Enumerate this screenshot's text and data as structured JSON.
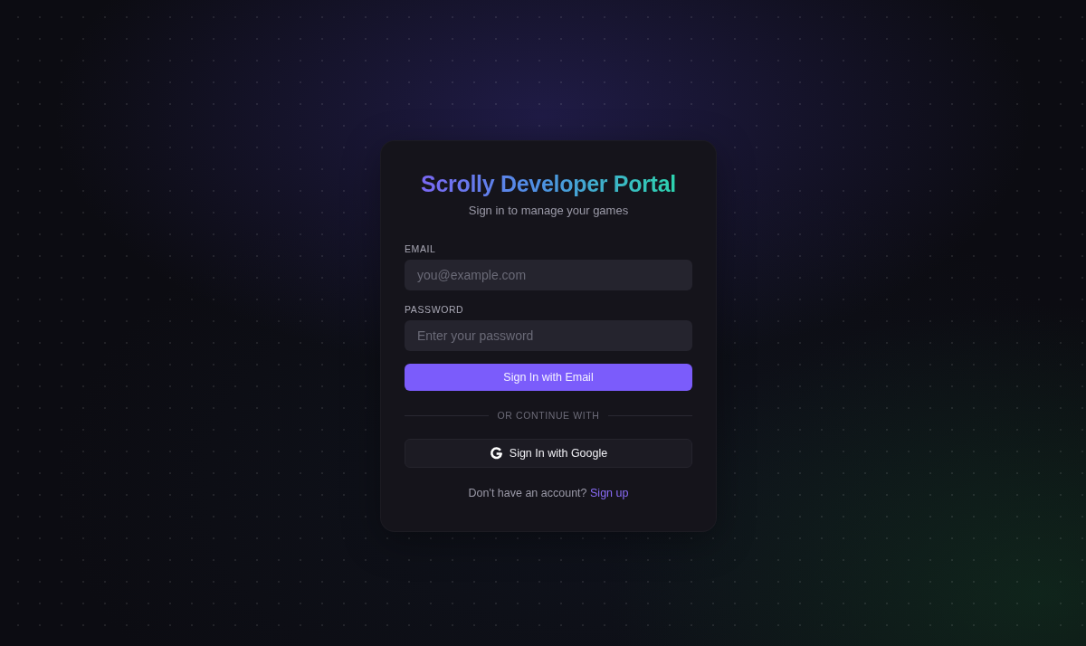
{
  "portal": {
    "title": "Scrolly Developer Portal",
    "subtitle": "Sign in to manage your games"
  },
  "form": {
    "fields": [
      {
        "label": "EMAIL",
        "placeholder": "you@example.com"
      },
      {
        "label": "PASSWORD",
        "placeholder": "Enter your password"
      }
    ],
    "primary_button": "Sign In with Email",
    "divider": "OR CONTINUE WITH",
    "google_button": "Sign In with Google"
  },
  "footer": {
    "prompt": "Don't have an account?",
    "link": "Sign up"
  }
}
